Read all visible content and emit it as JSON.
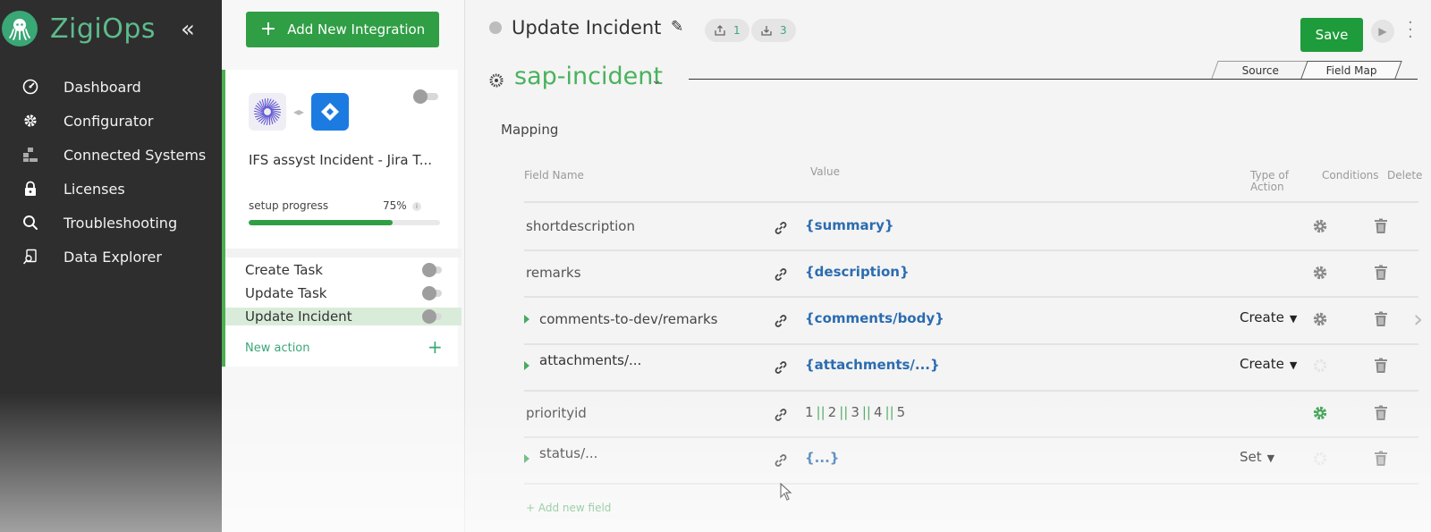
{
  "app": {
    "name": "ZigiOps"
  },
  "sidebar": {
    "collapse_glyph": "«",
    "items": [
      {
        "label": "Dashboard",
        "icon": "gauge-icon"
      },
      {
        "label": "Configurator",
        "icon": "gear-icon"
      },
      {
        "label": "Connected Systems",
        "icon": "boxes-icon"
      },
      {
        "label": "Licenses",
        "icon": "lock-icon"
      },
      {
        "label": "Troubleshooting",
        "icon": "search-icon"
      },
      {
        "label": "Data Explorer",
        "icon": "data-explorer-icon"
      }
    ]
  },
  "integrations": {
    "add_button": "Add New Integration",
    "card": {
      "title": "IFS assyst Incident - Jira T...",
      "progress_label": "setup progress",
      "progress_text": "75%",
      "progress": 0.75,
      "info": "i",
      "actions": [
        {
          "label": "Create Task",
          "active": false
        },
        {
          "label": "Update Task",
          "active": false
        },
        {
          "label": "Update Incident",
          "active": true
        }
      ],
      "new_action": "New action",
      "new_action_plus": "+"
    }
  },
  "main": {
    "title": "Update Incident",
    "export_count": "1",
    "import_count": "3",
    "save": "Save",
    "entity": "sap-incident",
    "tabs": [
      "Source",
      "Field Map"
    ],
    "active_tab": "Field Map",
    "mapping_label": "Mapping",
    "columns": {
      "field_name": "Field Name",
      "value": "Value",
      "type_line1": "Type of",
      "type_line2": "Action",
      "conditions": "Conditions",
      "delete": "Delete"
    },
    "rows": [
      {
        "name": "shortdescription",
        "value": "{summary}",
        "expandable": false,
        "type": "",
        "gear_active": false,
        "gear_visible": true
      },
      {
        "name": "remarks",
        "value": "{description}",
        "expandable": false,
        "type": "",
        "gear_active": false,
        "gear_visible": true
      },
      {
        "name": "comments-to-dev/remarks",
        "value": "{comments/body}",
        "expandable": true,
        "type": "Create",
        "gear_active": false,
        "gear_visible": true
      },
      {
        "name": "attachments/...",
        "value": "{attachments/...}",
        "expandable": true,
        "type": "Create",
        "gear_active": false,
        "gear_visible": false
      },
      {
        "name": "priorityid",
        "value_parts": [
          "1",
          "2",
          "3",
          "4",
          "5"
        ],
        "expandable": false,
        "type": "",
        "gear_active": true,
        "gear_visible": true
      },
      {
        "name": "status/...",
        "value": "{...}",
        "expandable": true,
        "type": "Set",
        "gear_active": false,
        "gear_visible": false
      }
    ],
    "add_field": "+ Add new field"
  },
  "colors": {
    "brand_green": "#2f9e44",
    "sidebar_bg": "#2e2e2e",
    "value_blue": "#2b6cb0"
  }
}
